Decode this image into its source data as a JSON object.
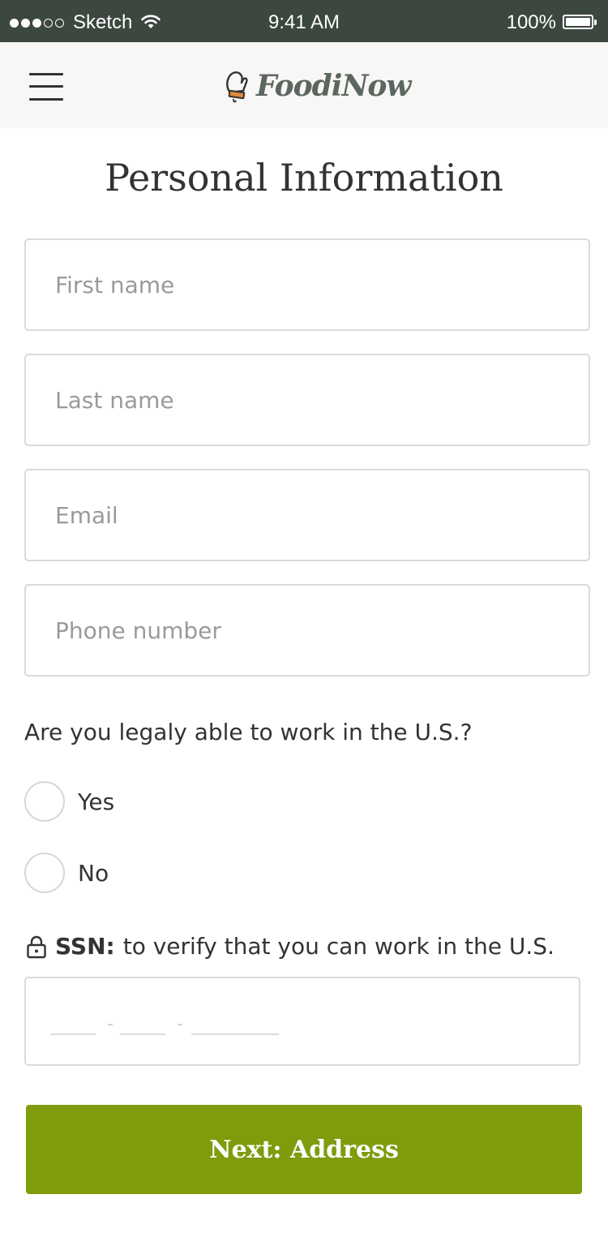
{
  "status_bar": {
    "carrier": "Sketch",
    "time": "9:41 AM",
    "battery": "100%"
  },
  "header": {
    "logo_text": "FoodiNow"
  },
  "form": {
    "title": "Personal Information",
    "fields": {
      "first_name_placeholder": "First name",
      "last_name_placeholder": "Last name",
      "email_placeholder": "Email",
      "phone_placeholder": "Phone number"
    },
    "work_question": "Are you legaly able to work in the U.S.?",
    "options": {
      "yes": "Yes",
      "no": "No"
    },
    "ssn": {
      "label_bold": "SSN:",
      "label_text": "to verify that you can work in the U.S."
    },
    "next_button": "Next: Address"
  },
  "colors": {
    "status_bar_bg": "#3c4740",
    "header_bg": "#f8f7f5",
    "accent_green": "#7f9c0d"
  }
}
